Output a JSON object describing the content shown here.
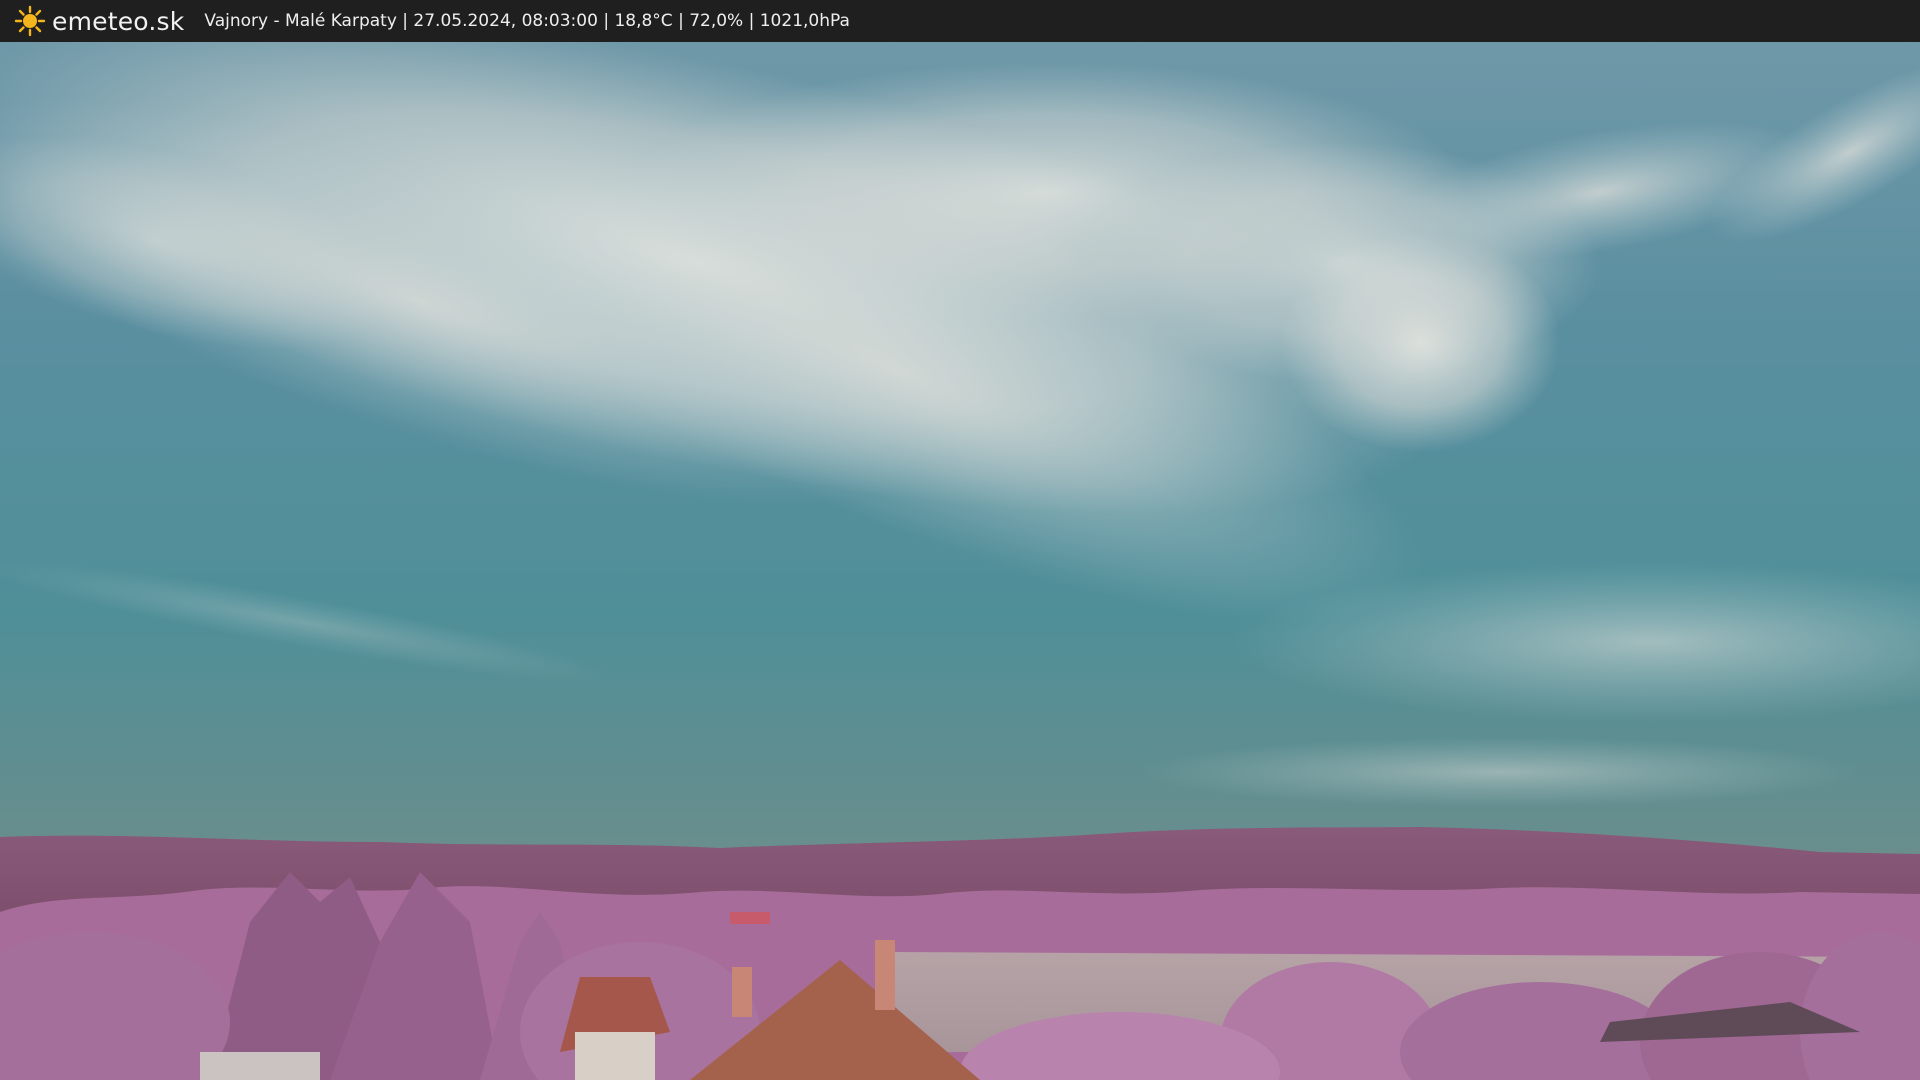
{
  "header": {
    "logo_icon": "sun-icon",
    "brand": "emeteo.sk",
    "info": "Vajnory - Malé Karpaty | 27.05.2024, 08:03:00 | 18,8°C | 72,0% | 1021,0hPa"
  },
  "colors": {
    "bar_background": "#1f1f1f",
    "sun_yellow": "#f5b51c",
    "sky_blue": "#4f8a9a",
    "vegetation_pink": "#9c6b95",
    "roof_brick": "#a4574a"
  }
}
